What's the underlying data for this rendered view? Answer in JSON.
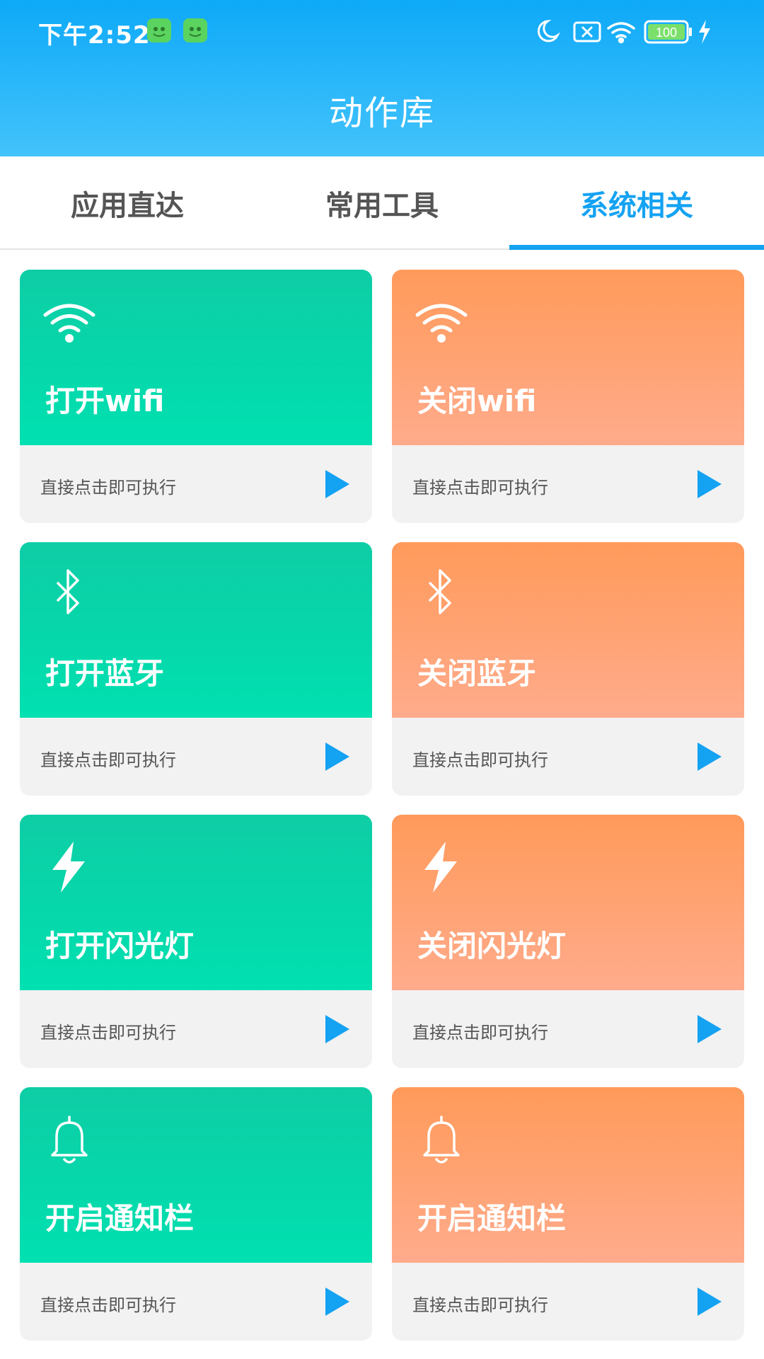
{
  "status_bar": {
    "time": "下午2:52",
    "battery": "100"
  },
  "header": {
    "title": "动作库"
  },
  "tabs": [
    {
      "label": "应用直达",
      "active": false
    },
    {
      "label": "常用工具",
      "active": false
    },
    {
      "label": "系统相关",
      "active": true
    }
  ],
  "colors": {
    "accent": "#14a2f2",
    "green_card": "#00dcb0",
    "orange_card": "#ff9d63",
    "play": "#14a2f2"
  },
  "cards": [
    {
      "title": "打开wifi",
      "hint": "直接点击即可执行",
      "icon": "wifi-icon",
      "color": "green"
    },
    {
      "title": "关闭wifi",
      "hint": "直接点击即可执行",
      "icon": "wifi-icon",
      "color": "orange"
    },
    {
      "title": "打开蓝牙",
      "hint": "直接点击即可执行",
      "icon": "bluetooth-icon",
      "color": "green"
    },
    {
      "title": "关闭蓝牙",
      "hint": "直接点击即可执行",
      "icon": "bluetooth-icon",
      "color": "orange"
    },
    {
      "title": "打开闪光灯",
      "hint": "直接点击即可执行",
      "icon": "flash-icon",
      "color": "green"
    },
    {
      "title": "关闭闪光灯",
      "hint": "直接点击即可执行",
      "icon": "flash-icon",
      "color": "orange"
    },
    {
      "title": "开启通知栏",
      "hint": "直接点击即可执行",
      "icon": "bell-icon",
      "color": "green"
    },
    {
      "title": "开启通知栏",
      "hint": "直接点击即可执行",
      "icon": "bell-icon",
      "color": "orange"
    }
  ]
}
